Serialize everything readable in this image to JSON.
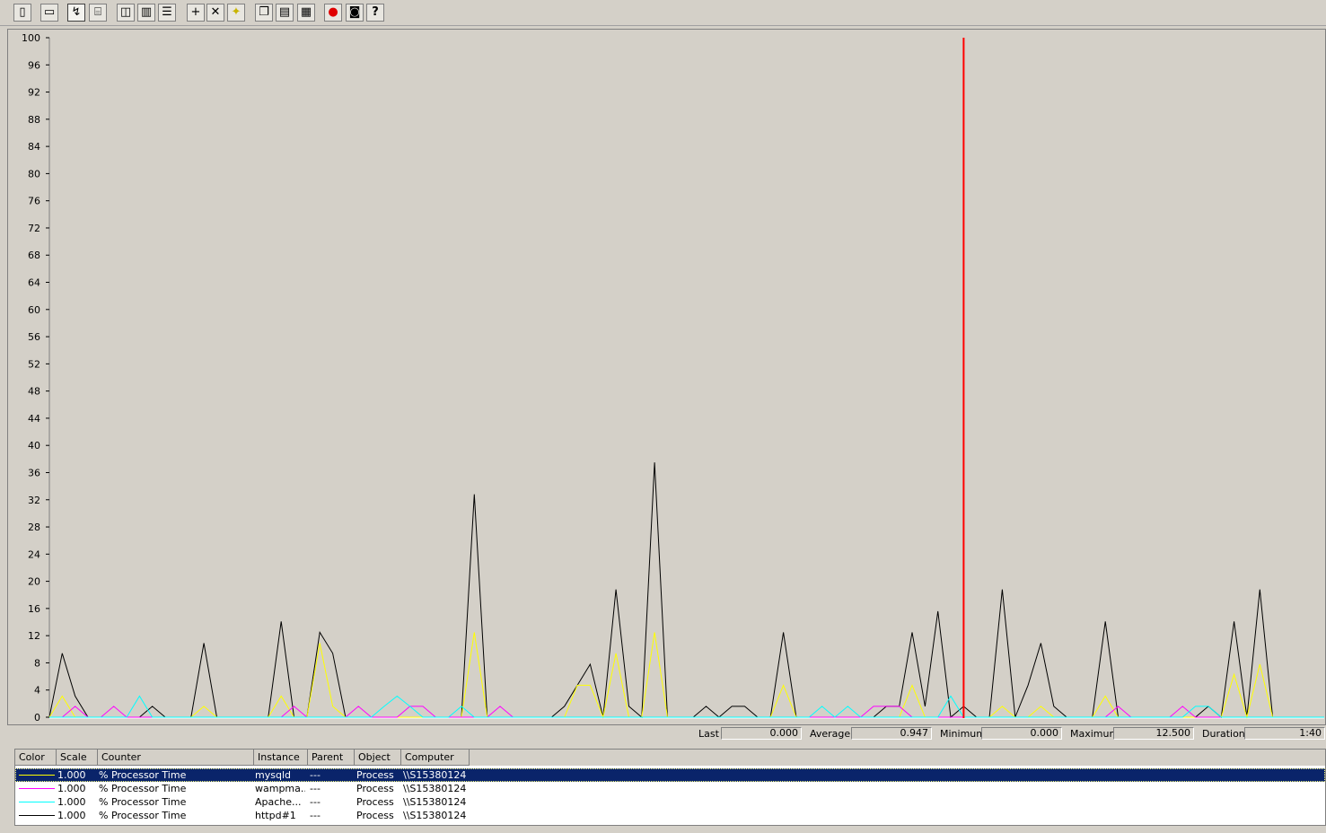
{
  "toolbar": {
    "buttons": [
      {
        "name": "new-counter-set-button",
        "icon": "new-document-icon",
        "glyph": "▯"
      },
      {
        "name": "clear-display-button",
        "icon": "clear-display-icon",
        "glyph": "▭"
      },
      {
        "name": "view-current-activity-button",
        "icon": "current-activity-icon",
        "glyph": "↯",
        "pressed": true
      },
      {
        "name": "view-log-data-button",
        "icon": "log-data-cylinder-icon",
        "glyph": "⌸"
      },
      {
        "name": "view-graph-button",
        "icon": "graph-view-icon",
        "glyph": "◫"
      },
      {
        "name": "view-histogram-button",
        "icon": "histogram-view-icon",
        "glyph": "▥"
      },
      {
        "name": "view-report-button",
        "icon": "report-view-icon",
        "glyph": "☰"
      },
      {
        "name": "add-counter-button",
        "icon": "plus-icon",
        "glyph": "+"
      },
      {
        "name": "delete-counter-button",
        "icon": "delete-x-icon",
        "glyph": "✕"
      },
      {
        "name": "highlight-button",
        "icon": "lightbulb-icon",
        "glyph": "✦"
      },
      {
        "name": "copy-properties-button",
        "icon": "copy-icon",
        "glyph": "❐"
      },
      {
        "name": "paste-counter-list-button",
        "icon": "paste-icon",
        "glyph": "▤"
      },
      {
        "name": "properties-button",
        "icon": "properties-icon",
        "glyph": "▦"
      },
      {
        "name": "freeze-display-button",
        "icon": "stop-circle-icon",
        "glyph": "●"
      },
      {
        "name": "update-data-button",
        "icon": "camera-icon",
        "glyph": "◙"
      },
      {
        "name": "help-button",
        "icon": "help-question-icon",
        "glyph": "?"
      }
    ]
  },
  "chart_data": {
    "type": "line",
    "ylim": [
      0,
      100
    ],
    "yticks": [
      0,
      4,
      8,
      12,
      16,
      20,
      24,
      28,
      32,
      36,
      40,
      44,
      48,
      52,
      56,
      60,
      64,
      68,
      72,
      76,
      80,
      84,
      88,
      92,
      96,
      100
    ],
    "sample_count": 100,
    "time_bar_index": 71,
    "grid": false,
    "series": [
      {
        "color": "#000000",
        "values": [
          0,
          9.4,
          3.1,
          0,
          0,
          0,
          0,
          0,
          1.6,
          0,
          0,
          0,
          10.9,
          0,
          0,
          0,
          0,
          0,
          14.1,
          0,
          0,
          12.5,
          9.4,
          0,
          0,
          0,
          0,
          0,
          0,
          0,
          0,
          0,
          0,
          32.8,
          0,
          0,
          0,
          0,
          0,
          0,
          1.6,
          4.7,
          7.8,
          0,
          18.8,
          1.6,
          0,
          37.5,
          0,
          0,
          0,
          1.6,
          0,
          1.6,
          1.6,
          0,
          0,
          12.5,
          0,
          0,
          0,
          0,
          0,
          0,
          0,
          1.6,
          1.6,
          12.5,
          1.6,
          15.6,
          0,
          1.6,
          0,
          0,
          18.8,
          0,
          4.7,
          10.9,
          1.6,
          0,
          0,
          0,
          14.1,
          0,
          0,
          0,
          0,
          0,
          0,
          0,
          1.6,
          0,
          14.1,
          0,
          18.8,
          0,
          0,
          0,
          0,
          0
        ]
      },
      {
        "color": "#ffff00",
        "values": [
          0,
          3.1,
          0,
          0,
          0,
          0,
          0,
          0,
          0,
          0,
          0,
          0,
          1.6,
          0,
          0,
          0,
          0,
          0,
          3.1,
          0,
          0,
          10.9,
          1.6,
          0,
          0,
          0,
          0,
          0,
          0,
          0,
          0,
          0,
          0,
          12.5,
          0,
          0,
          0,
          0,
          0,
          0,
          0,
          4.7,
          4.7,
          0,
          9.4,
          0,
          0,
          12.5,
          0,
          0,
          0,
          0,
          0,
          0,
          0,
          0,
          0,
          4.7,
          0,
          0,
          0,
          0,
          0,
          0,
          0,
          0,
          0,
          4.7,
          0,
          0,
          0,
          0,
          0,
          0,
          1.6,
          0,
          0,
          1.6,
          0,
          0,
          0,
          0,
          3.1,
          0,
          0,
          0,
          0,
          0,
          0,
          0,
          0,
          0,
          6.3,
          0,
          7.8,
          0,
          0,
          0,
          0,
          0
        ]
      },
      {
        "color": "#ff00ff",
        "values": [
          0,
          0,
          1.6,
          0,
          0,
          1.6,
          0,
          0,
          0,
          0,
          0,
          0,
          0,
          0,
          0,
          0,
          0,
          0,
          0,
          1.6,
          0,
          0,
          0,
          0,
          1.6,
          0,
          0,
          0,
          1.6,
          1.6,
          0,
          0,
          0,
          0,
          0,
          1.6,
          0,
          0,
          0,
          0,
          0,
          0,
          0,
          0,
          0,
          0,
          0,
          0,
          0,
          0,
          0,
          0,
          0,
          0,
          0,
          0,
          0,
          0,
          0,
          0,
          0,
          0,
          0,
          0,
          1.6,
          1.6,
          1.6,
          0,
          0,
          0,
          0,
          0,
          0,
          0,
          0,
          0,
          0,
          0,
          0,
          0,
          0,
          0,
          0,
          1.6,
          0,
          0,
          0,
          0,
          1.6,
          0,
          0,
          0,
          0,
          0,
          0,
          0,
          0,
          0,
          0,
          0
        ]
      },
      {
        "color": "#00ffff",
        "values": [
          0,
          0,
          0,
          0,
          0,
          0,
          0,
          3.1,
          0,
          0,
          0,
          0,
          0,
          0,
          0,
          0,
          0,
          0,
          0,
          0,
          0,
          0,
          0,
          0,
          0,
          0,
          1.6,
          3.1,
          1.6,
          0,
          0,
          0,
          1.6,
          0,
          0,
          0,
          0,
          0,
          0,
          0,
          0,
          0,
          0,
          0,
          0,
          0,
          0,
          0,
          0,
          0,
          0,
          0,
          0,
          0,
          0,
          0,
          0,
          0,
          0,
          0,
          1.6,
          0,
          1.6,
          0,
          0,
          0,
          0,
          0,
          0,
          0,
          3.1,
          0,
          0,
          0,
          0,
          0,
          0,
          0,
          0,
          0,
          0,
          0,
          0,
          0,
          0,
          0,
          0,
          0,
          0,
          1.6,
          1.6,
          0,
          0,
          0,
          0,
          0,
          0,
          0,
          0,
          0
        ]
      }
    ]
  },
  "stats": {
    "last_label": "Last",
    "last_value": "0.000",
    "average_label": "Average",
    "average_value": "0.947",
    "minimum_label": "Minimum",
    "minimum_value": "0.000",
    "maximum_label": "Maximum",
    "maximum_value": "12.500",
    "duration_label": "Duration",
    "duration_value": "1:40"
  },
  "legend": {
    "columns": [
      "Color",
      "Scale",
      "Counter",
      "Instance",
      "Parent",
      "Object",
      "Computer"
    ],
    "rows": [
      {
        "color": "#ffff00",
        "scale": "1.000",
        "counter": "% Processor Time",
        "instance": "mysqld",
        "parent": "---",
        "object": "Process",
        "computer": "\\\\S15380124",
        "selected": true
      },
      {
        "color": "#ff00ff",
        "scale": "1.000",
        "counter": "% Processor Time",
        "instance": "wampma...",
        "parent": "---",
        "object": "Process",
        "computer": "\\\\S15380124",
        "selected": false
      },
      {
        "color": "#00ffff",
        "scale": "1.000",
        "counter": "% Processor Time",
        "instance": "Apache...",
        "parent": "---",
        "object": "Process",
        "computer": "\\\\S15380124",
        "selected": false
      },
      {
        "color": "#000000",
        "scale": "1.000",
        "counter": "% Processor Time",
        "instance": "httpd#1",
        "parent": "---",
        "object": "Process",
        "computer": "\\\\S15380124",
        "selected": false
      }
    ]
  }
}
